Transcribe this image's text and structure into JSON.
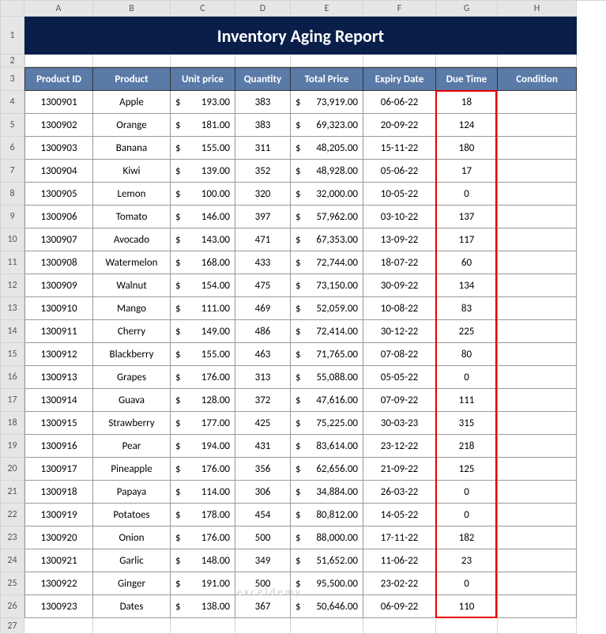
{
  "title": "Inventory Aging Report",
  "watermark": "exceldemy",
  "colHeaders": [
    "A",
    "B",
    "C",
    "D",
    "E",
    "F",
    "G",
    "H"
  ],
  "headers": [
    "Product ID",
    "Product",
    "Unit price",
    "Quantity",
    "Total Price",
    "Expiry Date",
    "Due Time",
    "Condition"
  ],
  "rows": [
    {
      "id": "1300901",
      "product": "Apple",
      "unit": "193.00",
      "qty": "383",
      "total": "73,919.00",
      "expiry": "06-06-22",
      "due": "18",
      "cond": ""
    },
    {
      "id": "1300902",
      "product": "Orange",
      "unit": "181.00",
      "qty": "383",
      "total": "69,323.00",
      "expiry": "20-09-22",
      "due": "124",
      "cond": ""
    },
    {
      "id": "1300903",
      "product": "Banana",
      "unit": "155.00",
      "qty": "311",
      "total": "48,205.00",
      "expiry": "15-11-22",
      "due": "180",
      "cond": ""
    },
    {
      "id": "1300904",
      "product": "Kiwi",
      "unit": "139.00",
      "qty": "352",
      "total": "48,928.00",
      "expiry": "05-06-22",
      "due": "17",
      "cond": ""
    },
    {
      "id": "1300905",
      "product": "Lemon",
      "unit": "100.00",
      "qty": "320",
      "total": "32,000.00",
      "expiry": "10-05-22",
      "due": "0",
      "cond": ""
    },
    {
      "id": "1300906",
      "product": "Tomato",
      "unit": "146.00",
      "qty": "397",
      "total": "57,962.00",
      "expiry": "03-10-22",
      "due": "137",
      "cond": ""
    },
    {
      "id": "1300907",
      "product": "Avocado",
      "unit": "143.00",
      "qty": "471",
      "total": "67,353.00",
      "expiry": "13-09-22",
      "due": "117",
      "cond": ""
    },
    {
      "id": "1300908",
      "product": "Watermelon",
      "unit": "168.00",
      "qty": "433",
      "total": "72,744.00",
      "expiry": "18-07-22",
      "due": "60",
      "cond": ""
    },
    {
      "id": "1300909",
      "product": "Walnut",
      "unit": "154.00",
      "qty": "475",
      "total": "73,150.00",
      "expiry": "30-09-22",
      "due": "134",
      "cond": ""
    },
    {
      "id": "1300910",
      "product": "Mango",
      "unit": "111.00",
      "qty": "469",
      "total": "52,059.00",
      "expiry": "10-08-22",
      "due": "83",
      "cond": ""
    },
    {
      "id": "1300911",
      "product": "Cherry",
      "unit": "149.00",
      "qty": "486",
      "total": "72,414.00",
      "expiry": "30-12-22",
      "due": "225",
      "cond": ""
    },
    {
      "id": "1300912",
      "product": "Blackberry",
      "unit": "155.00",
      "qty": "463",
      "total": "71,765.00",
      "expiry": "07-08-22",
      "due": "80",
      "cond": ""
    },
    {
      "id": "1300913",
      "product": "Grapes",
      "unit": "176.00",
      "qty": "313",
      "total": "55,088.00",
      "expiry": "05-05-22",
      "due": "0",
      "cond": ""
    },
    {
      "id": "1300914",
      "product": "Guava",
      "unit": "128.00",
      "qty": "372",
      "total": "47,616.00",
      "expiry": "07-09-22",
      "due": "111",
      "cond": ""
    },
    {
      "id": "1300915",
      "product": "Strawberry",
      "unit": "177.00",
      "qty": "425",
      "total": "75,225.00",
      "expiry": "30-03-23",
      "due": "315",
      "cond": ""
    },
    {
      "id": "1300916",
      "product": "Pear",
      "unit": "194.00",
      "qty": "431",
      "total": "83,614.00",
      "expiry": "23-12-22",
      "due": "218",
      "cond": ""
    },
    {
      "id": "1300917",
      "product": "Pineapple",
      "unit": "176.00",
      "qty": "356",
      "total": "62,656.00",
      "expiry": "21-09-22",
      "due": "125",
      "cond": ""
    },
    {
      "id": "1300918",
      "product": "Papaya",
      "unit": "114.00",
      "qty": "306",
      "total": "34,884.00",
      "expiry": "26-03-22",
      "due": "0",
      "cond": ""
    },
    {
      "id": "1300919",
      "product": "Potatoes",
      "unit": "178.00",
      "qty": "454",
      "total": "80,812.00",
      "expiry": "14-05-22",
      "due": "0",
      "cond": ""
    },
    {
      "id": "1300920",
      "product": "Onion",
      "unit": "176.00",
      "qty": "500",
      "total": "88,000.00",
      "expiry": "17-11-22",
      "due": "182",
      "cond": ""
    },
    {
      "id": "1300921",
      "product": "Garlic",
      "unit": "148.00",
      "qty": "349",
      "total": "51,652.00",
      "expiry": "11-06-22",
      "due": "23",
      "cond": ""
    },
    {
      "id": "1300922",
      "product": "Ginger",
      "unit": "191.00",
      "qty": "500",
      "total": "95,500.00",
      "expiry": "23-02-22",
      "due": "0",
      "cond": ""
    },
    {
      "id": "1300923",
      "product": "Dates",
      "unit": "138.00",
      "qty": "367",
      "total": "50,646.00",
      "expiry": "06-09-22",
      "due": "110",
      "cond": ""
    }
  ],
  "dollar": "$"
}
